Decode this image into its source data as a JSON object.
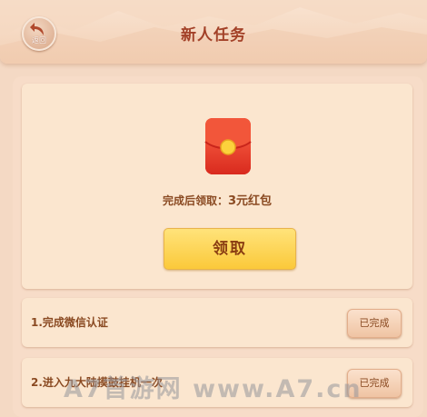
{
  "header": {
    "back_label": "返回",
    "title": "新人任务"
  },
  "reward": {
    "prefix": "完成后领取：",
    "amount": "3元红包",
    "claim_label": "领取"
  },
  "tasks": [
    {
      "label": "1.完成微信认证",
      "status": "已完成"
    },
    {
      "label": "2.进入九大陆摸鼓挂机一次",
      "status": "已完成"
    }
  ],
  "watermark": "A7首游网  www.A7.cn",
  "colors": {
    "title": "#a34128",
    "text": "#8a4a22",
    "claim_button": "#fbc93a",
    "red_packet": "#e8432c"
  }
}
